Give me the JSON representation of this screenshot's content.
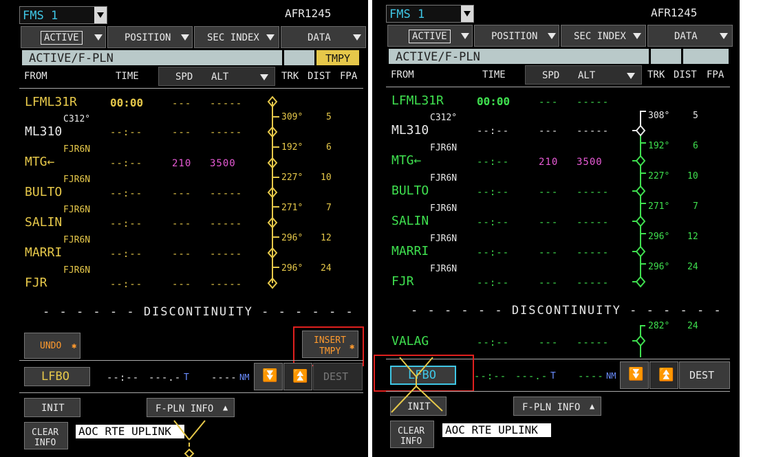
{
  "left": {
    "fms_label": "FMS 1",
    "flight_id": "AFR1245",
    "tabs": [
      "ACTIVE",
      "POSITION",
      "SEC INDEX",
      "DATA"
    ],
    "title": "ACTIVE/F-PLN",
    "tmpy_badge": "TMPY",
    "headers": {
      "from": "FROM",
      "time": "TIME",
      "spd": "SPD",
      "alt": "ALT",
      "trk": "TRK",
      "dist": "DIST",
      "fpa": "FPA"
    },
    "origin": {
      "name": "LFML31R",
      "time": "00:00",
      "spd": "---",
      "alt": "-----"
    },
    "rows": [
      {
        "via": "C312°",
        "name": "ML310",
        "time": "--:--",
        "spd": "---",
        "alt": "-----",
        "trk": "309°",
        "dist": "5"
      },
      {
        "via": "FJR6N",
        "name": "MTG←",
        "time": "--:--",
        "spd": "210",
        "alt": "3500",
        "trk": "192°",
        "dist": "6"
      },
      {
        "via": "FJR6N",
        "name": "BULTO",
        "time": "--:--",
        "spd": "---",
        "alt": "-----",
        "trk": "227°",
        "dist": "10"
      },
      {
        "via": "FJR6N",
        "name": "SALIN",
        "time": "--:--",
        "spd": "---",
        "alt": "-----",
        "trk": "271°",
        "dist": "7"
      },
      {
        "via": "FJR6N",
        "name": "MARRI",
        "time": "--:--",
        "spd": "---",
        "alt": "-----",
        "trk": "296°",
        "dist": "12"
      },
      {
        "via": "FJR6N",
        "name": "FJR",
        "time": "--:--",
        "spd": "---",
        "alt": "-----",
        "trk": "296°",
        "dist": "24"
      }
    ],
    "discontinuity": "- - - - - - DISCONTINUITY - - - - - -",
    "undo_label": "UNDO",
    "insert_label_1": "INSERT",
    "insert_label_2": "TMPY",
    "dest_name": "LFBO",
    "dest_time": "--:--",
    "dest_fuel": "---.-",
    "dest_fuel_unit": "T",
    "dest_dist": "----",
    "dest_dist_unit": "NM",
    "dest_button": "DEST",
    "init_label": "INIT",
    "fpln_info_label": "F-PLN INFO",
    "clear_info_1": "CLEAR",
    "clear_info_2": "INFO",
    "aoc_label": "AOC RTE UPLINK"
  },
  "right": {
    "fms_label": "FMS 1",
    "flight_id": "AFR1245",
    "tabs": [
      "ACTIVE",
      "POSITION",
      "SEC INDEX",
      "DATA"
    ],
    "title": "ACTIVE/F-PLN",
    "headers": {
      "from": "FROM",
      "time": "TIME",
      "spd": "SPD",
      "alt": "ALT",
      "trk": "TRK",
      "dist": "DIST",
      "fpa": "FPA"
    },
    "origin": {
      "name": "LFML31R",
      "time": "00:00",
      "spd": "---",
      "alt": "-----"
    },
    "rows": [
      {
        "via": "C312°",
        "name": "ML310",
        "time": "--:--",
        "spd": "---",
        "alt": "-----",
        "trk": "308°",
        "dist": "5"
      },
      {
        "via": "FJR6N",
        "name": "MTG←",
        "time": "--:--",
        "spd": "210",
        "alt": "3500",
        "trk": "192°",
        "dist": "6"
      },
      {
        "via": "FJR6N",
        "name": "BULTO",
        "time": "--:--",
        "spd": "---",
        "alt": "-----",
        "trk": "227°",
        "dist": "10"
      },
      {
        "via": "FJR6N",
        "name": "SALIN",
        "time": "--:--",
        "spd": "---",
        "alt": "-----",
        "trk": "271°",
        "dist": "7"
      },
      {
        "via": "FJR6N",
        "name": "MARRI",
        "time": "--:--",
        "spd": "---",
        "alt": "-----",
        "trk": "296°",
        "dist": "12"
      },
      {
        "via": "FJR6N",
        "name": "FJR",
        "time": "--:--",
        "spd": "---",
        "alt": "-----",
        "trk": "296°",
        "dist": "24"
      }
    ],
    "discontinuity": "- - - - - - DISCONTINUITY - - - - - -",
    "after_disc": {
      "name": "VALAG",
      "time": "--:--",
      "spd": "---",
      "alt": "-----",
      "trk": "282°",
      "dist": "24"
    },
    "dest_name": "LFBO",
    "dest_time": "--:--",
    "dest_fuel": "---.-",
    "dest_fuel_unit": "T",
    "dest_dist": "----",
    "dest_dist_unit": "NM",
    "dest_button": "DEST",
    "init_label": "INIT",
    "fpln_info_label": "F-PLN INFO",
    "clear_info_1": "CLEAR",
    "clear_info_2": "INFO",
    "aoc_label": "AOC RTE UPLINK"
  }
}
